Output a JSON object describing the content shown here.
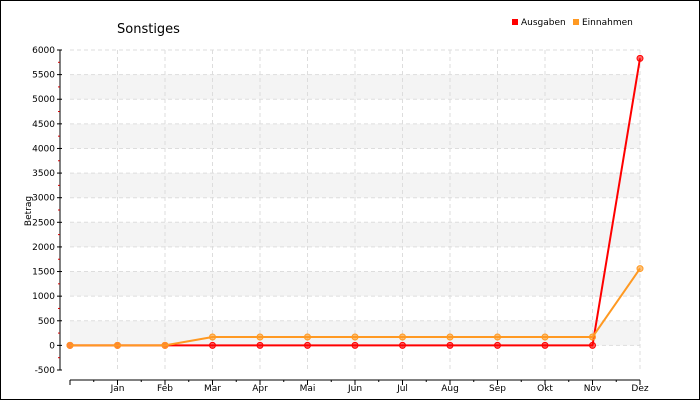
{
  "chart_data": {
    "type": "line",
    "title": "Sonstiges",
    "xlabel": "",
    "ylabel": "Betrag",
    "categories": [
      "",
      "Jan",
      "Feb",
      "Mar",
      "Apr",
      "Mai",
      "Jun",
      "Jul",
      "Aug",
      "Sep",
      "Okt",
      "Nov",
      "Dez"
    ],
    "ylim": [
      -500,
      6000
    ],
    "yticks": [
      -500,
      0,
      500,
      1000,
      1500,
      2000,
      2500,
      3000,
      3500,
      4000,
      4500,
      5000,
      5500,
      6000
    ],
    "grid": true,
    "legend_position": "top-right",
    "series": [
      {
        "name": "Ausgaben",
        "color": "#ff0000",
        "values": [
          0,
          0,
          0,
          0,
          0,
          0,
          0,
          0,
          0,
          0,
          0,
          0,
          5830
        ]
      },
      {
        "name": "Einnahmen",
        "color": "#ff9922",
        "values": [
          0,
          0,
          0,
          170,
          170,
          170,
          170,
          170,
          170,
          170,
          170,
          170,
          1560
        ]
      }
    ]
  }
}
